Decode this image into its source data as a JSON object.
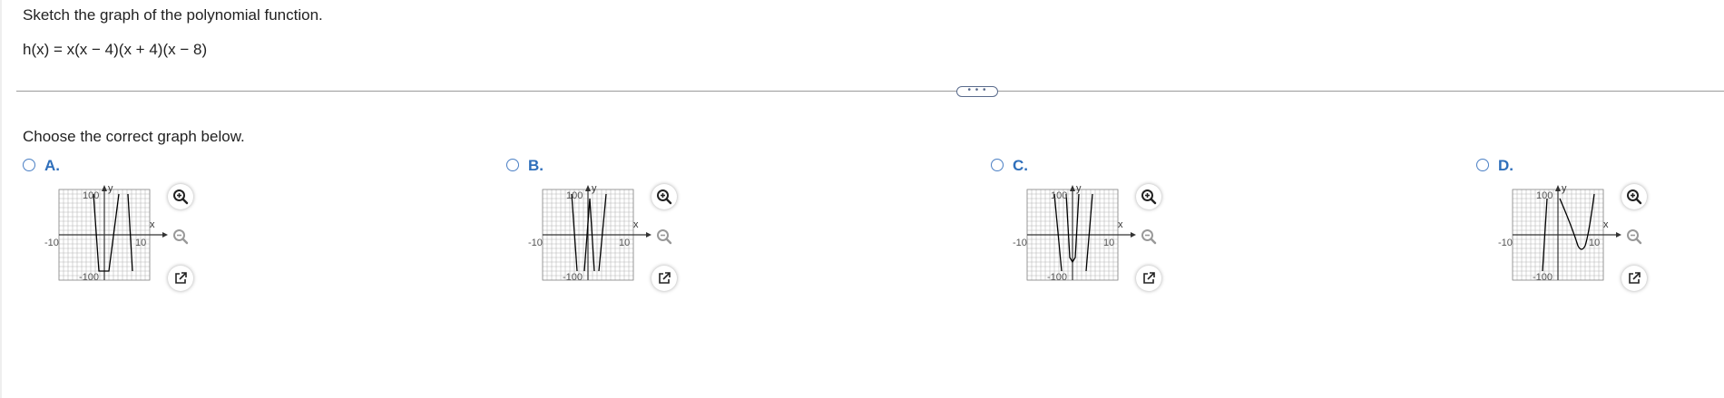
{
  "question": {
    "prompt": "Sketch the graph of the polynomial function.",
    "function": "h(x) = x(x − 4)(x + 4)(x − 8)",
    "expander_label": "• • •",
    "instruction": "Choose the correct graph below."
  },
  "options": [
    {
      "letter": "A."
    },
    {
      "letter": "B."
    },
    {
      "letter": "C."
    },
    {
      "letter": "D."
    }
  ],
  "axis": {
    "x_label": "x",
    "y_label": "y",
    "x_min_label": "-10",
    "x_max_label": "10",
    "y_max_label": "100",
    "y_min_label": "-100"
  },
  "icons": {
    "zoom_in": "zoom-in-icon",
    "zoom_out": "zoom-out-icon",
    "pop_out": "external-link-icon"
  },
  "colors": {
    "accent_blue": "#2f6fbb",
    "grid": "#b8b8b8",
    "curve": "#000000"
  }
}
